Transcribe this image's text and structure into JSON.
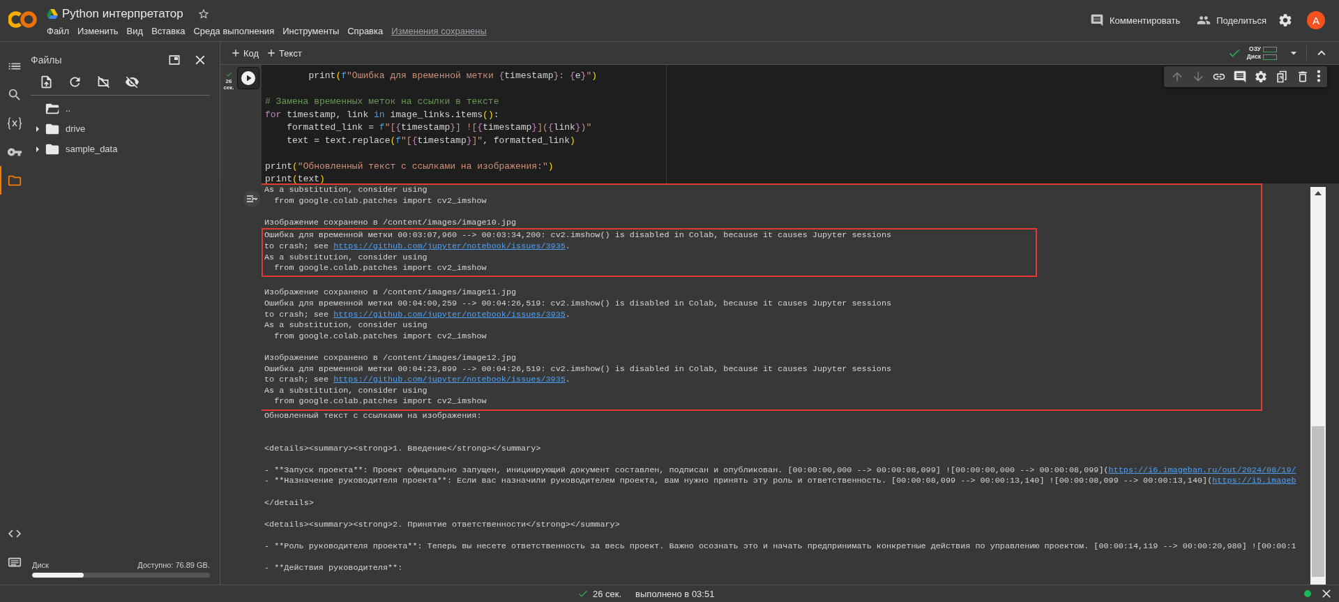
{
  "header": {
    "title": "Python интерпретатор",
    "menu": [
      "Файл",
      "Изменить",
      "Вид",
      "Вставка",
      "Среда выполнения",
      "Инструменты",
      "Справка"
    ],
    "save_status": "Изменения сохранены",
    "actions": [
      {
        "kind": "comment",
        "label": "Комментировать"
      },
      {
        "kind": "share",
        "label": "Поделиться"
      }
    ],
    "avatar": "A"
  },
  "rail": [
    {
      "kind": "toc",
      "selected": false
    },
    {
      "kind": "search",
      "selected": false
    },
    {
      "kind": "variables",
      "selected": false
    },
    {
      "kind": "secrets",
      "selected": false
    },
    {
      "kind": "files",
      "selected": true
    }
  ],
  "rail_bottom": [
    {
      "kind": "code"
    },
    {
      "kind": "terminal"
    }
  ],
  "files": {
    "title": "Файлы",
    "tree": [
      {
        "kind": "parent",
        "name": ".."
      },
      {
        "kind": "folder",
        "name": "drive",
        "expanded": false
      },
      {
        "kind": "folder",
        "name": "sample_data",
        "expanded": false
      }
    ],
    "disk": {
      "label": "Диск",
      "available": "Доступно: 76.89 GB.",
      "level": 0.29
    }
  },
  "toolbar": {
    "add_buttons": [
      {
        "label": "Код"
      },
      {
        "label": "Текст"
      }
    ],
    "ram_label": "ОЗУ",
    "disk_label": "Диск"
  },
  "cell": {
    "run_time": "26 сек.",
    "code": [
      {
        "kind": "code",
        "tokens": [
          {
            "kind": "plain",
            "text": "        print"
          },
          {
            "kind": "paren",
            "text": "("
          },
          {
            "kind": "fprefix",
            "text": "f"
          },
          {
            "kind": "string",
            "text": "\"Ошибка для временной метки "
          },
          {
            "kind": "fbrace",
            "text": "{"
          },
          {
            "kind": "plain",
            "text": "timestamp"
          },
          {
            "kind": "fbrace",
            "text": "}"
          },
          {
            "kind": "string",
            "text": ": "
          },
          {
            "kind": "fbrace",
            "text": "{"
          },
          {
            "kind": "plain",
            "text": "e"
          },
          {
            "kind": "fbrace",
            "text": "}"
          },
          {
            "kind": "string",
            "text": "\""
          },
          {
            "kind": "paren",
            "text": ")"
          }
        ]
      },
      {
        "kind": "blank"
      },
      {
        "kind": "code",
        "tokens": [
          {
            "kind": "comment",
            "text": "# Замена временных меток на ссылки в тексте"
          }
        ]
      },
      {
        "kind": "code",
        "tokens": [
          {
            "kind": "keyword",
            "text": "for"
          },
          {
            "kind": "plain",
            "text": " timestamp, link "
          },
          {
            "kind": "operator",
            "text": "in"
          },
          {
            "kind": "plain",
            "text": " image_links.items"
          },
          {
            "kind": "paren",
            "text": "()"
          },
          {
            "kind": "plain",
            "text": ":"
          }
        ]
      },
      {
        "kind": "code",
        "tokens": [
          {
            "kind": "plain",
            "text": "    formatted_link = "
          },
          {
            "kind": "fprefix",
            "text": "f"
          },
          {
            "kind": "string",
            "text": "\"["
          },
          {
            "kind": "fbrace",
            "text": "{"
          },
          {
            "kind": "plain",
            "text": "timestamp"
          },
          {
            "kind": "fbrace",
            "text": "}"
          },
          {
            "kind": "string",
            "text": "] !["
          },
          {
            "kind": "fbrace",
            "text": "{"
          },
          {
            "kind": "plain",
            "text": "timestamp"
          },
          {
            "kind": "fbrace",
            "text": "}"
          },
          {
            "kind": "string",
            "text": "]("
          },
          {
            "kind": "fbrace",
            "text": "{"
          },
          {
            "kind": "plain",
            "text": "link"
          },
          {
            "kind": "fbrace",
            "text": "}"
          },
          {
            "kind": "string",
            "text": ")\""
          }
        ]
      },
      {
        "kind": "code",
        "tokens": [
          {
            "kind": "plain",
            "text": "    text = text.replace"
          },
          {
            "kind": "paren",
            "text": "("
          },
          {
            "kind": "fprefix",
            "text": "f"
          },
          {
            "kind": "string",
            "text": "\"["
          },
          {
            "kind": "fbrace",
            "text": "{"
          },
          {
            "kind": "plain",
            "text": "timestamp"
          },
          {
            "kind": "fbrace",
            "text": "}"
          },
          {
            "kind": "string",
            "text": "]\""
          },
          {
            "kind": "plain",
            "text": ", formatted_link"
          },
          {
            "kind": "paren",
            "text": ")"
          }
        ]
      },
      {
        "kind": "blank"
      },
      {
        "kind": "code",
        "tokens": [
          {
            "kind": "plain",
            "text": "print"
          },
          {
            "kind": "paren",
            "text": "("
          },
          {
            "kind": "string",
            "text": "\"Обновленный текст с ссылками на изображения:\""
          },
          {
            "kind": "paren",
            "text": ")"
          }
        ]
      },
      {
        "kind": "code",
        "tokens": [
          {
            "kind": "plain",
            "text": "print"
          },
          {
            "kind": "paren",
            "text": "("
          },
          {
            "kind": "plain",
            "text": "text"
          },
          {
            "kind": "paren",
            "text": ")"
          }
        ]
      }
    ],
    "output": [
      {
        "kind": "frame",
        "items": [
          {
            "kind": "text",
            "text": "As a substitution, consider using"
          },
          {
            "kind": "text",
            "text": "  from google.colab.patches import cv2_imshow"
          },
          {
            "kind": "blank"
          },
          {
            "kind": "text",
            "text": "Изображение сохранено в /content/images/image10.jpg"
          },
          {
            "kind": "frame",
            "items": [
              {
                "kind": "text",
                "text": "Ошибка для временной метки 00:03:07,960 --> 00:03:34,200: cv2.imshow() is disabled in Colab, because it causes Jupyter sessions"
              },
              {
                "kind": "link",
                "before": "to crash; see ",
                "link": "https://github.com/jupyter/notebook/issues/3935",
                "after": "."
              },
              {
                "kind": "text",
                "text": "As a substitution, consider using"
              },
              {
                "kind": "text",
                "text": "  from google.colab.patches import cv2_imshow"
              }
            ]
          },
          {
            "kind": "blank"
          },
          {
            "kind": "text",
            "text": "Изображение сохранено в /content/images/image11.jpg"
          },
          {
            "kind": "text",
            "text": "Ошибка для временной метки 00:04:00,259 --> 00:04:26,519: cv2.imshow() is disabled in Colab, because it causes Jupyter sessions"
          },
          {
            "kind": "link",
            "before": "to crash; see ",
            "link": "https://github.com/jupyter/notebook/issues/3935",
            "after": "."
          },
          {
            "kind": "text",
            "text": "As a substitution, consider using"
          },
          {
            "kind": "text",
            "text": "  from google.colab.patches import cv2_imshow"
          },
          {
            "kind": "blank"
          },
          {
            "kind": "text",
            "text": "Изображение сохранено в /content/images/image12.jpg"
          },
          {
            "kind": "text",
            "text": "Ошибка для временной метки 00:04:23,899 --> 00:04:26,519: cv2.imshow() is disabled in Colab, because it causes Jupyter sessions"
          },
          {
            "kind": "link",
            "before": "to crash; see ",
            "link": "https://github.com/jupyter/notebook/issues/3935",
            "after": "."
          },
          {
            "kind": "text",
            "text": "As a substitution, consider using"
          },
          {
            "kind": "text",
            "text": "  from google.colab.patches import cv2_imshow"
          }
        ]
      },
      {
        "kind": "text",
        "text": "Обновленный текст с ссылками на изображения:"
      },
      {
        "kind": "blank"
      },
      {
        "kind": "blank"
      },
      {
        "kind": "text",
        "text": "<details><summary><strong>1. Введение</strong></summary>"
      },
      {
        "kind": "blank"
      },
      {
        "kind": "link",
        "before": "- **Запуск проекта**: Проект официально запущен, инициирующий документ составлен, подписан и опубликован. [00:00:00,000 --> 00:00:08,099] ![00:00:00,000 --> 00:00:08,099](",
        "link": "https://i6.imageban.ru/out/2024/08/19/"
      },
      {
        "kind": "link",
        "before": "- **Назначение руководителя проекта**: Если вас назначили руководителем проекта, вам нужно принять эту роль и ответственность. [00:00:08,099 --> 00:00:13,140] ![00:00:08,099 --> 00:00:13,140](",
        "link": "https://i5.imageb"
      },
      {
        "kind": "blank"
      },
      {
        "kind": "text",
        "text": "</details>"
      },
      {
        "kind": "blank"
      },
      {
        "kind": "text",
        "text": "<details><summary><strong>2. Принятие ответственности</strong></summary>"
      },
      {
        "kind": "blank"
      },
      {
        "kind": "text",
        "text": "- **Роль руководителя проекта**: Теперь вы несете ответственность за весь проект. Важно осознать это и начать предпринимать конкретные действия по управлению проектом. [00:00:14,119 --> 00:00:20,980] ![00:00:1"
      },
      {
        "kind": "blank"
      },
      {
        "kind": "text",
        "text": "- **Действия руководителя**:"
      }
    ]
  },
  "status_bar": {
    "duration": "26 сек.",
    "completed": "выполнено в 03:51"
  }
}
